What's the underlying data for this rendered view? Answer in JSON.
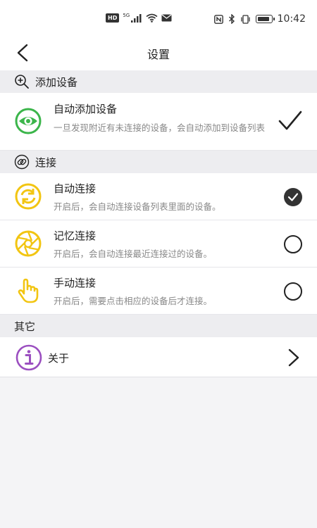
{
  "status_bar": {
    "hd": "HD",
    "network": "5G",
    "time": "10:42"
  },
  "header": {
    "title": "设置"
  },
  "sections": {
    "add_device": {
      "title": "添加设备",
      "item": {
        "title": "自动添加设备",
        "description": "一旦发现附近有未连接的设备，会自动添加到设备列表",
        "checked": true
      }
    },
    "connect": {
      "title": "连接",
      "items": [
        {
          "title": "自动连接",
          "description": "开启后，会自动连接设备列表里面的设备。",
          "selected": true
        },
        {
          "title": "记忆连接",
          "description": "开启后，会自动连接最近连接过的设备。",
          "selected": false
        },
        {
          "title": "手动连接",
          "description": "开启后，需要点击相应的设备后才连接。",
          "selected": false
        }
      ]
    },
    "other": {
      "title": "其它",
      "about_label": "关于"
    }
  },
  "colors": {
    "green": "#3bb54a",
    "yellow": "#f2c512",
    "purple": "#9b4fc0"
  }
}
